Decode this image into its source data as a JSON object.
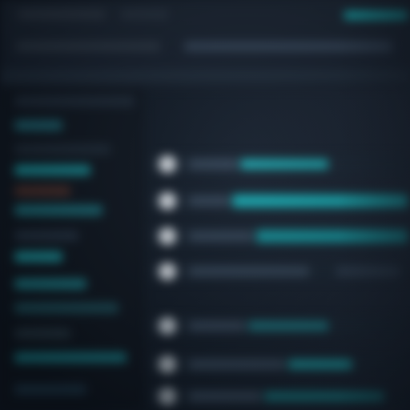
{
  "theme": {
    "background": "#0d141f",
    "sidebar_background": "#0f1722",
    "accent": "#15b6bc",
    "bullet": "#d6dde4"
  },
  "sidebar": {
    "items": [
      {
        "icon": "sidebar-line"
      },
      {
        "icon": "sidebar-line"
      },
      {
        "icon": "sidebar-line"
      },
      {
        "icon": "sidebar-line"
      },
      {
        "icon": "sidebar-line"
      },
      {
        "icon": "sidebar-line"
      },
      {
        "icon": "sidebar-line"
      },
      {
        "icon": "sidebar-line"
      },
      {
        "icon": "sidebar-line"
      },
      {
        "icon": "sidebar-line"
      },
      {
        "icon": "sidebar-line"
      },
      {
        "icon": "sidebar-line"
      }
    ]
  },
  "list": {
    "items": [
      {
        "bullet": "circle-bullet"
      },
      {
        "bullet": "circle-bullet"
      },
      {
        "bullet": "circle-bullet"
      },
      {
        "bullet": "circle-bullet"
      },
      {
        "bullet": "circle-bullet"
      },
      {
        "bullet": "circle-bullet"
      },
      {
        "bullet": "circle-bullet"
      }
    ]
  }
}
